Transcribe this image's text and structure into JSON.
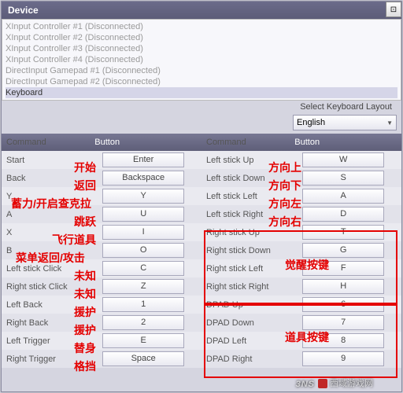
{
  "window": {
    "btn_icon": "⊡"
  },
  "panel_title": "Device",
  "devices": [
    "XInput Controller #1 (Disconnected)",
    "XInput Controller #2 (Disconnected)",
    "XInput Controller #3 (Disconnected)",
    "XInput Controller #4 (Disconnected)",
    "DirectInput Gamepad #1 (Disconnected)",
    "DirectInput Gamepad #2 (Disconnected)",
    "Keyboard"
  ],
  "kb": {
    "label": "Select Keyboard Layout",
    "value": "English"
  },
  "headers": {
    "command": "Command",
    "button": "Button"
  },
  "left": [
    {
      "cmd": "Start",
      "btn": "Enter"
    },
    {
      "cmd": "Back",
      "btn": "Backspace"
    },
    {
      "cmd": "Y",
      "btn": "Y"
    },
    {
      "cmd": "A",
      "btn": "U"
    },
    {
      "cmd": "X",
      "btn": "I"
    },
    {
      "cmd": "B",
      "btn": "O"
    },
    {
      "cmd": "Left stick Click",
      "btn": "C"
    },
    {
      "cmd": "Right stick Click",
      "btn": "Z"
    },
    {
      "cmd": "Left Back",
      "btn": "1"
    },
    {
      "cmd": "Right Back",
      "btn": "2"
    },
    {
      "cmd": "Left Trigger",
      "btn": "E"
    },
    {
      "cmd": "Right Trigger",
      "btn": "Space"
    }
  ],
  "right": [
    {
      "cmd": "Left stick Up",
      "btn": "W"
    },
    {
      "cmd": "Left stick Down",
      "btn": "S"
    },
    {
      "cmd": "Left stick Left",
      "btn": "A"
    },
    {
      "cmd": "Left stick Right",
      "btn": "D"
    },
    {
      "cmd": "Right stick Up",
      "btn": "T"
    },
    {
      "cmd": "Right stick Down",
      "btn": "G"
    },
    {
      "cmd": "Right stick Left",
      "btn": "F"
    },
    {
      "cmd": "Right stick Right",
      "btn": "H"
    },
    {
      "cmd": "DPAD Up",
      "btn": "6"
    },
    {
      "cmd": "DPAD Down",
      "btn": "7"
    },
    {
      "cmd": "DPAD Left",
      "btn": "8"
    },
    {
      "cmd": "DPAD Right",
      "btn": "9"
    }
  ],
  "annotations": {
    "start": "开始",
    "back": "返回",
    "y": "蓄力/开启查克拉",
    "a": "跳跃",
    "x": "飞行道具",
    "b": "菜单返回/攻击",
    "lsc": "未知",
    "rsc": "未知",
    "lb": "援护",
    "rb": "援护",
    "lt": "替身",
    "rt": "格挡",
    "up": "方向上",
    "down": "方向下",
    "leftd": "方向左",
    "rightd": "方向右",
    "awaken": "觉醒按键",
    "item": "道具按键"
  },
  "watermark": {
    "brand": "3NS",
    "site": "西域游戏网"
  }
}
